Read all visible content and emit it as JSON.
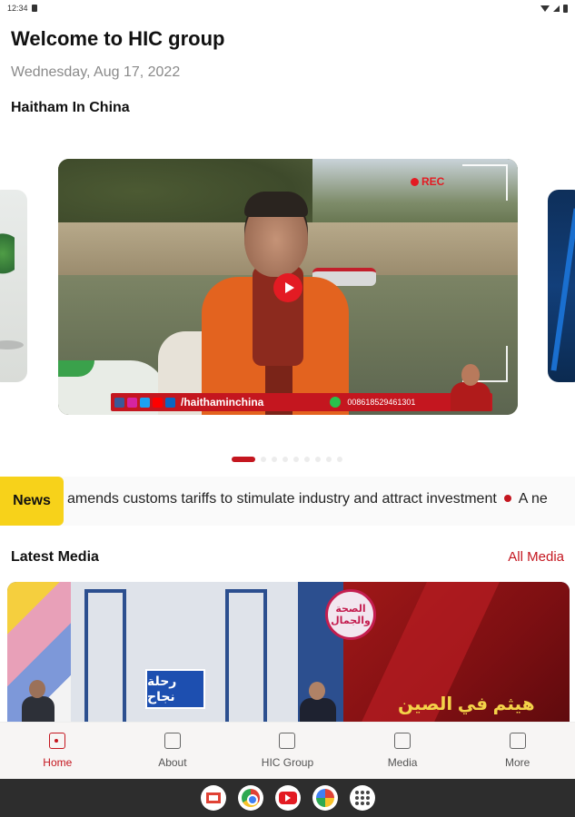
{
  "status_bar": {
    "time": "12:34"
  },
  "header": {
    "welcome": "Welcome to HIC group",
    "date": "Wednesday, Aug 17, 2022",
    "section": "Haitham In China"
  },
  "carousel": {
    "active_index": 0,
    "total": 9,
    "slide": {
      "rec_label": "REC",
      "handle": "/haithaminchina",
      "phone": "008618529461301"
    }
  },
  "news": {
    "label": "News",
    "ticker": "amends customs tariffs to stimulate industry and attract investment",
    "ticker_next": "A ne"
  },
  "latest_media": {
    "title": "Latest Media",
    "all_link": "All Media",
    "card": {
      "logo_text": "رحلة نجاح",
      "circle_text": "الصحة والجمال",
      "title_ar": "هيثم في الصين"
    }
  },
  "bottom_nav": {
    "items": [
      {
        "label": "Home",
        "icon": "home-icon",
        "active": true
      },
      {
        "label": "About",
        "icon": "about-icon",
        "active": false
      },
      {
        "label": "HIC Group",
        "icon": "hic-group-icon",
        "active": false
      },
      {
        "label": "Media",
        "icon": "media-icon",
        "active": false
      },
      {
        "label": "More",
        "icon": "more-icon",
        "active": false
      }
    ]
  },
  "colors": {
    "accent": "#c4161f",
    "news_label": "#f7d21a"
  }
}
